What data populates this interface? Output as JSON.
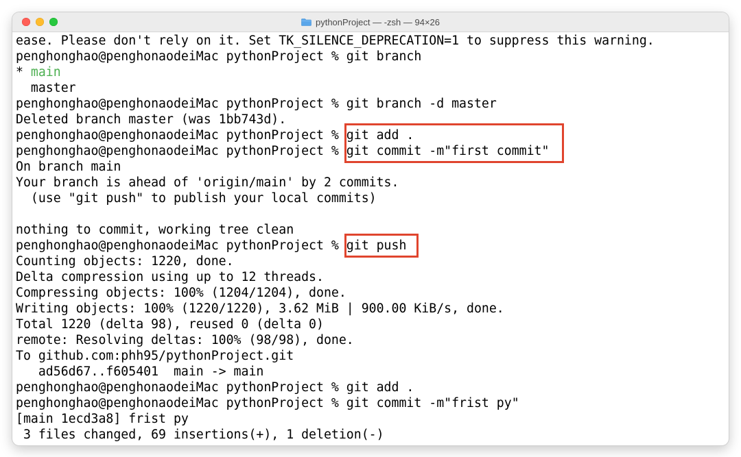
{
  "window": {
    "title": "pythonProject — -zsh — 94×26"
  },
  "terminal": {
    "prompt": "penghonghao@penghonaodeiMac pythonProject % ",
    "lines": {
      "l1": "ease. Please don't rely on it. Set TK_SILENCE_DEPRECATION=1 to suppress this warning.",
      "l2_cmd": "git branch",
      "l3_star": "* ",
      "l3_branch": "main",
      "l4": "  master",
      "l5_cmd": "git branch -d master",
      "l6": "Deleted branch master (was 1bb743d).",
      "l7_cmd": "git add .",
      "l8_cmd": "git commit -m\"first commit\"",
      "l9": "On branch main",
      "l10": "Your branch is ahead of 'origin/main' by 2 commits.",
      "l11": "  (use \"git push\" to publish your local commits)",
      "l12": "",
      "l13": "nothing to commit, working tree clean",
      "l14_cmd": "git push",
      "l15": "Counting objects: 1220, done.",
      "l16": "Delta compression using up to 12 threads.",
      "l17": "Compressing objects: 100% (1204/1204), done.",
      "l18": "Writing objects: 100% (1220/1220), 3.62 MiB | 900.00 KiB/s, done.",
      "l19": "Total 1220 (delta 98), reused 0 (delta 0)",
      "l20": "remote: Resolving deltas: 100% (98/98), done.",
      "l21": "To github.com:phh95/pythonProject.git",
      "l22": "   ad56d67..f605401  main -> main",
      "l23_cmd": "git add .",
      "l24_cmd": "git commit -m\"frist py\"",
      "l25": "[main 1ecd3a8] frist py",
      "l26": " 3 files changed, 69 insertions(+), 1 deletion(-)"
    }
  },
  "colors": {
    "current_branch": "#4caf50",
    "highlight_box": "#e0452e"
  },
  "icons": {
    "title_icon": "folder-icon"
  }
}
